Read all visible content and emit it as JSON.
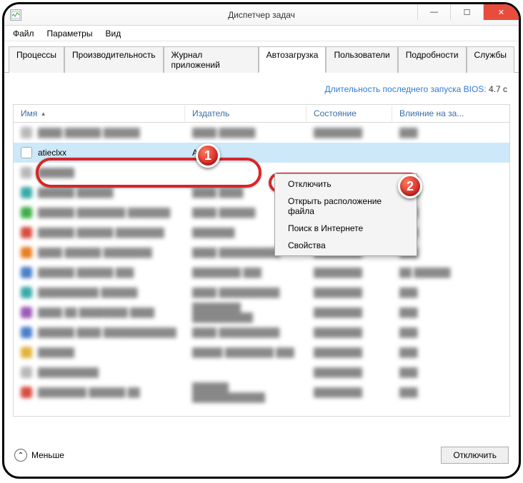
{
  "window": {
    "title": "Диспетчер задач",
    "icon": "task-manager-icon"
  },
  "menu": {
    "file": "Файл",
    "options": "Параметры",
    "view": "Вид"
  },
  "tabs": {
    "processes": "Процессы",
    "performance": "Производительность",
    "app_history": "Журнал приложений",
    "startup": "Автозагрузка",
    "users": "Пользователи",
    "details": "Подробности",
    "services": "Службы"
  },
  "bios": {
    "label": "Длительность последнего запуска BIOS:",
    "value": "4.7 c"
  },
  "columns": {
    "name": "Имя",
    "publisher": "Издатель",
    "status": "Состояние",
    "impact": "Влияние на за..."
  },
  "rows": {
    "selected": {
      "name": "atieclxx",
      "publisher": "Advan"
    }
  },
  "context_menu": {
    "disable": "Отключить",
    "open_location": "Открыть расположение файла",
    "search_online": "Поиск в Интернете",
    "properties": "Свойства"
  },
  "footer": {
    "fewer": "Меньше",
    "disable": "Отключить"
  },
  "annotations": {
    "badge1": "1",
    "badge2": "2"
  }
}
